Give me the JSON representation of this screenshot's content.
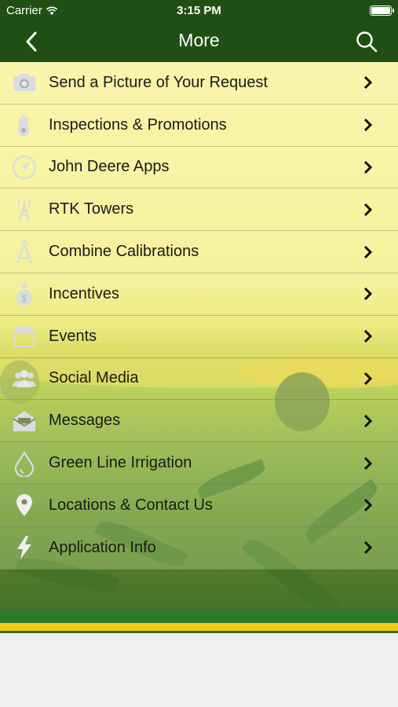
{
  "status_bar": {
    "carrier": "Carrier",
    "time": "3:15 PM",
    "battery": "full"
  },
  "nav": {
    "title": "More",
    "back_icon": "chevron-left-icon",
    "search_icon": "search-icon"
  },
  "menu": {
    "items": [
      {
        "label": "Send a Picture of Your Request",
        "icon": "camera-icon"
      },
      {
        "label": "Inspections & Promotions",
        "icon": "tractor-icon"
      },
      {
        "label": "John Deere Apps",
        "icon": "navigation-arrow-icon"
      },
      {
        "label": "RTK Towers",
        "icon": "tower-icon"
      },
      {
        "label": "Combine Calibrations",
        "icon": "compass-icon"
      },
      {
        "label": "Incentives",
        "icon": "money-bag-icon"
      },
      {
        "label": "Events",
        "icon": "calendar-icon"
      },
      {
        "label": "Social Media",
        "icon": "people-icon"
      },
      {
        "label": "Messages",
        "icon": "envelope-icon"
      },
      {
        "label": "Green Line Irrigation",
        "icon": "water-drop-icon"
      },
      {
        "label": "Locations & Contact Us",
        "icon": "location-pin-icon"
      },
      {
        "label": "Application Info",
        "icon": "lightning-icon"
      }
    ]
  },
  "colors": {
    "nav_green": "#1f4f15",
    "stripe_green": "#2b7a2a",
    "stripe_yellow": "#f1cc1a"
  }
}
